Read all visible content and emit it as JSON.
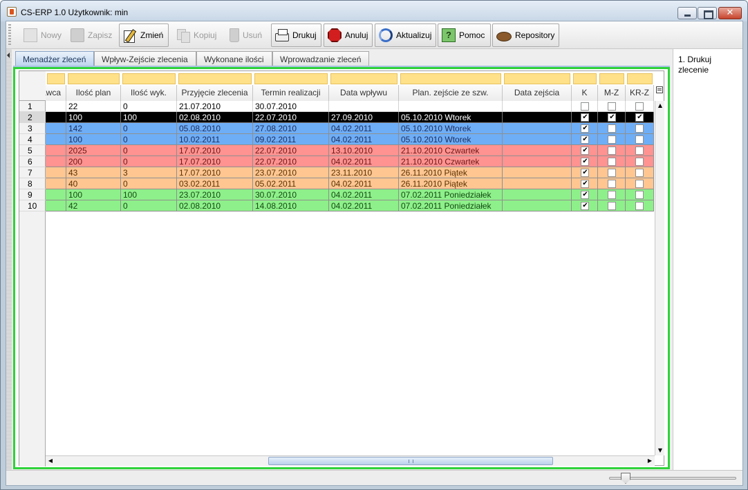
{
  "window": {
    "title": "CS-ERP 1.0  Użytkownik: min"
  },
  "toolbar": [
    {
      "label": "Nowy",
      "icon": "new-icon",
      "enabled": false
    },
    {
      "label": "Zapisz",
      "icon": "save-icon",
      "enabled": false
    },
    {
      "label": "Zmień",
      "icon": "edit-icon",
      "enabled": true
    },
    {
      "label": "Kopiuj",
      "icon": "copy-icon",
      "enabled": false
    },
    {
      "label": "Usuń",
      "icon": "trash-icon",
      "enabled": false
    },
    {
      "label": "Drukuj",
      "icon": "printer-icon",
      "enabled": true
    },
    {
      "label": "Anuluj",
      "icon": "stop-icon",
      "enabled": true
    },
    {
      "label": "Aktualizuj",
      "icon": "refresh-icon",
      "enabled": true
    },
    {
      "label": "Pomoc",
      "icon": "help-icon",
      "enabled": true
    },
    {
      "label": "Repository",
      "icon": "repository-icon",
      "enabled": true
    }
  ],
  "tabs": [
    "Menadżer zleceń",
    "Wpływ-Zejście zlecenia",
    "Wykonane ilości",
    "Wprowadzanie zleceń"
  ],
  "active_tab": 0,
  "table": {
    "columns": [
      "awca",
      "Ilość plan",
      "Ilość wyk.",
      "Przyjęcie zlecenia",
      "Termin realizacji",
      "Data wpływu",
      "Plan. zejście ze szw.",
      "Data zejścia",
      "K",
      "M-Z",
      "KR-Z"
    ],
    "row_colors": {
      "white": "#ffffff",
      "black": "#000000",
      "blue": "#6eaef7",
      "red": "#ff9391",
      "orange": "#ffc692",
      "green": "#8ef08a"
    },
    "filter_color": "#ffe18a",
    "rows": [
      {
        "num": "1",
        "color": "white",
        "awca": "",
        "plan": "22",
        "wyk": "0",
        "przyjecie": "21.07.2010",
        "termin": "30.07.2010",
        "wplyw": "",
        "plan_zejscie": "",
        "data_zejscia": "",
        "k": false,
        "mz": false,
        "krz": false
      },
      {
        "num": "2",
        "color": "black",
        "awca": "",
        "plan": "100",
        "wyk": "100",
        "przyjecie": "02.08.2010",
        "termin": "22.07.2010",
        "wplyw": "27.09.2010",
        "plan_zejscie": "05.10.2010 Wtorek",
        "data_zejscia": "",
        "k": true,
        "mz": true,
        "krz": true
      },
      {
        "num": "3",
        "color": "blue",
        "awca": "",
        "plan": "142",
        "wyk": "0",
        "przyjecie": "05.08.2010",
        "termin": "27.08.2010",
        "wplyw": "04.02.2011",
        "plan_zejscie": "05.10.2010 Wtorek",
        "data_zejscia": "",
        "k": true,
        "mz": false,
        "krz": false
      },
      {
        "num": "4",
        "color": "blue",
        "awca": "",
        "plan": "100",
        "wyk": "0",
        "przyjecie": "10.02.2011",
        "termin": "09.02.2011",
        "wplyw": "04.02.2011",
        "plan_zejscie": "05.10.2010 Wtorek",
        "data_zejscia": "",
        "k": true,
        "mz": false,
        "krz": false
      },
      {
        "num": "5",
        "color": "red",
        "awca": "",
        "plan": "2025",
        "wyk": "0",
        "przyjecie": "17.07.2010",
        "termin": "22.07.2010",
        "wplyw": "13.10.2010",
        "plan_zejscie": "21.10.2010 Czwartek",
        "data_zejscia": "",
        "k": true,
        "mz": false,
        "krz": false
      },
      {
        "num": "6",
        "color": "red",
        "awca": "",
        "plan": "200",
        "wyk": "0",
        "przyjecie": "17.07.2010",
        "termin": "22.07.2010",
        "wplyw": "04.02.2011",
        "plan_zejscie": "21.10.2010 Czwartek",
        "data_zejscia": "",
        "k": true,
        "mz": false,
        "krz": false
      },
      {
        "num": "7",
        "color": "orange",
        "awca": "",
        "plan": "43",
        "wyk": "3",
        "przyjecie": "17.07.2010",
        "termin": "23.07.2010",
        "wplyw": "23.11.2010",
        "plan_zejscie": "26.11.2010 Piątek",
        "data_zejscia": "",
        "k": true,
        "mz": false,
        "krz": false
      },
      {
        "num": "8",
        "color": "orange",
        "awca": "",
        "plan": "40",
        "wyk": "0",
        "przyjecie": "03.02.2011",
        "termin": "05.02.2011",
        "wplyw": "04.02.2011",
        "plan_zejscie": "26.11.2010 Piątek",
        "data_zejscia": "",
        "k": true,
        "mz": false,
        "krz": false
      },
      {
        "num": "9",
        "color": "green",
        "awca": "",
        "plan": "100",
        "wyk": "100",
        "przyjecie": "23.07.2010",
        "termin": "30.07.2010",
        "wplyw": "04.02.2011",
        "plan_zejscie": "07.02.2011 Poniedziałek",
        "data_zejscia": "",
        "k": true,
        "mz": false,
        "krz": false
      },
      {
        "num": "10",
        "color": "green",
        "awca": "",
        "plan": "42",
        "wyk": "0",
        "przyjecie": "02.08.2010",
        "termin": "14.08.2010",
        "wplyw": "04.02.2011",
        "plan_zejscie": "07.02.2011 Poniedziałek",
        "data_zejscia": "",
        "k": true,
        "mz": false,
        "krz": false
      }
    ]
  },
  "side_panel": {
    "text": "1. Drukuj zlecenie"
  },
  "selected_row": "2"
}
